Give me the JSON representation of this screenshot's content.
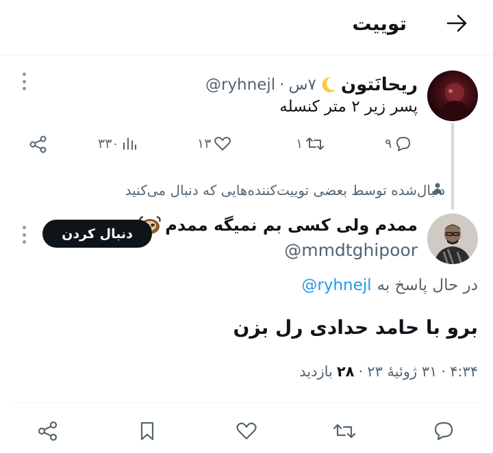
{
  "header": {
    "title": "توییت",
    "back_icon": "arrow-right-icon"
  },
  "parent_tweet": {
    "display_name": "ریحانَتون",
    "name_emoji_icon": "crescent-moon-icon",
    "handle": "@ryhnejl",
    "separator": "·",
    "time": "۷س",
    "text": "پسر زیر ۲ متر کنسله",
    "stats": {
      "replies": "۹",
      "retweets": "۱",
      "likes": "۱۳",
      "views": "۳۳۰"
    }
  },
  "social_context": "دنبال‌شده توسط بعضی توییت‌کننده‌هایی که دنبال می‌کنید",
  "main_tweet": {
    "display_name": "ممدم ولی کسی بم نمیگه ممدم",
    "name_emoji_icon": "sloth-icon",
    "handle": "@mmdtghipoor",
    "follow_label": "دنبال کردن",
    "replying_to_label": "در حال پاسخ به",
    "replying_to_handle": "@ryhnejl",
    "text": "برو با حامد حدادی رل بزن",
    "time": "۴:۳۴",
    "date": "۳۱ ژوئیهٔ ۲۳",
    "separator": "·",
    "views_count": "۲۸",
    "views_label": "بازدید"
  },
  "colors": {
    "accent": "#1d9bf0",
    "muted": "#536471",
    "text": "#0f1419",
    "border": "#eff3f4"
  }
}
